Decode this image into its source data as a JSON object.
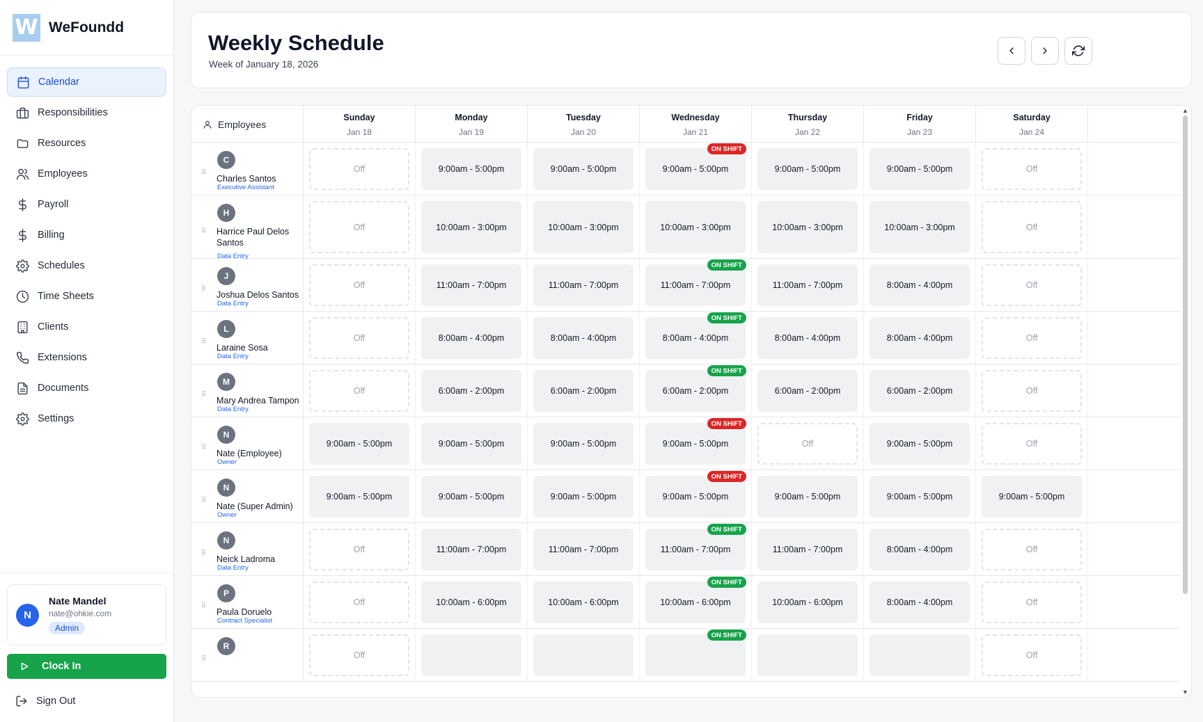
{
  "brand": {
    "logo_letter": "W",
    "name": "WeFoundd"
  },
  "sidebar": {
    "items": [
      {
        "label": "Calendar",
        "icon": "calendar-icon",
        "active": true
      },
      {
        "label": "Responsibilities",
        "icon": "briefcase-icon"
      },
      {
        "label": "Resources",
        "icon": "folder-icon"
      },
      {
        "label": "Employees",
        "icon": "users-icon"
      },
      {
        "label": "Payroll",
        "icon": "dollar-icon"
      },
      {
        "label": "Billing",
        "icon": "dollar-icon"
      },
      {
        "label": "Schedules",
        "icon": "gear-icon"
      },
      {
        "label": "Time Sheets",
        "icon": "clock-icon"
      },
      {
        "label": "Clients",
        "icon": "building-icon"
      },
      {
        "label": "Extensions",
        "icon": "phone-icon"
      },
      {
        "label": "Documents",
        "icon": "document-icon"
      },
      {
        "label": "Settings",
        "icon": "gear-icon"
      }
    ]
  },
  "user": {
    "initial": "N",
    "name": "Nate Mandel",
    "email": "nate@ohkie.com",
    "role": "Admin"
  },
  "clock_in_label": "Clock In",
  "sign_out_label": "Sign Out",
  "header": {
    "title": "Weekly Schedule",
    "subtitle": "Week of January 18, 2026"
  },
  "schedule": {
    "employees_header": "Employees",
    "days": [
      {
        "name": "Sunday",
        "date": "Jan 18"
      },
      {
        "name": "Monday",
        "date": "Jan 19"
      },
      {
        "name": "Tuesday",
        "date": "Jan 20"
      },
      {
        "name": "Wednesday",
        "date": "Jan 21"
      },
      {
        "name": "Thursday",
        "date": "Jan 22"
      },
      {
        "name": "Friday",
        "date": "Jan 23"
      },
      {
        "name": "Saturday",
        "date": "Jan 24"
      }
    ],
    "rows": [
      {
        "initial": "C",
        "name": "Charles Santos",
        "role": "Executive Assistant",
        "shifts": [
          "Off",
          "9:00am - 5:00pm",
          "9:00am - 5:00pm",
          "9:00am - 5:00pm",
          "9:00am - 5:00pm",
          "9:00am - 5:00pm",
          "Off"
        ],
        "badge": {
          "label": "ON SHIFT",
          "color": "#dc2626"
        }
      },
      {
        "initial": "H",
        "name": "Harrice Paul Delos Santos",
        "role": "Data Entry",
        "shifts": [
          "Off",
          "10:00am - 3:00pm",
          "10:00am - 3:00pm",
          "10:00am - 3:00pm",
          "10:00am - 3:00pm",
          "10:00am - 3:00pm",
          "Off"
        ],
        "badge": null
      },
      {
        "initial": "J",
        "name": "Joshua Delos Santos",
        "role": "Data Entry",
        "shifts": [
          "Off",
          "11:00am - 7:00pm",
          "11:00am - 7:00pm",
          "11:00am - 7:00pm",
          "11:00am - 7:00pm",
          "8:00am - 4:00pm",
          "Off"
        ],
        "badge": {
          "label": "ON SHIFT",
          "color": "#16a34a"
        }
      },
      {
        "initial": "L",
        "name": "Laraine Sosa",
        "role": "Data Entry",
        "shifts": [
          "Off",
          "8:00am - 4:00pm",
          "8:00am - 4:00pm",
          "8:00am - 4:00pm",
          "8:00am - 4:00pm",
          "8:00am - 4:00pm",
          "Off"
        ],
        "badge": {
          "label": "ON SHIFT",
          "color": "#16a34a"
        }
      },
      {
        "initial": "M",
        "name": "Mary Andrea Tampon",
        "role": "Data Entry",
        "shifts": [
          "Off",
          "6:00am - 2:00pm",
          "6:00am - 2:00pm",
          "6:00am - 2:00pm",
          "6:00am - 2:00pm",
          "6:00am - 2:00pm",
          "Off"
        ],
        "badge": {
          "label": "ON SHIFT",
          "color": "#16a34a"
        }
      },
      {
        "initial": "N",
        "name": "Nate (Employee)",
        "role": "Owner",
        "shifts": [
          "9:00am - 5:00pm",
          "9:00am - 5:00pm",
          "9:00am - 5:00pm",
          "9:00am - 5:00pm",
          "Off",
          "9:00am - 5:00pm",
          "Off"
        ],
        "badge": {
          "label": "ON SHIFT",
          "color": "#dc2626"
        }
      },
      {
        "initial": "N",
        "name": "Nate (Super Admin)",
        "role": "Owner",
        "shifts": [
          "9:00am - 5:00pm",
          "9:00am - 5:00pm",
          "9:00am - 5:00pm",
          "9:00am - 5:00pm",
          "9:00am - 5:00pm",
          "9:00am - 5:00pm",
          "9:00am - 5:00pm"
        ],
        "badge": {
          "label": "ON SHIFT",
          "color": "#dc2626"
        }
      },
      {
        "initial": "N",
        "name": "Neick Ladroma",
        "role": "Data Entry",
        "shifts": [
          "Off",
          "11:00am - 7:00pm",
          "11:00am - 7:00pm",
          "11:00am - 7:00pm",
          "11:00am - 7:00pm",
          "8:00am - 4:00pm",
          "Off"
        ],
        "badge": {
          "label": "ON SHIFT",
          "color": "#16a34a"
        }
      },
      {
        "initial": "P",
        "name": "Paula Doruelo",
        "role": "Contract Specialist",
        "shifts": [
          "Off",
          "10:00am - 6:00pm",
          "10:00am - 6:00pm",
          "10:00am - 6:00pm",
          "10:00am - 6:00pm",
          "8:00am - 4:00pm",
          "Off"
        ],
        "badge": {
          "label": "ON SHIFT",
          "color": "#16a34a"
        }
      },
      {
        "initial": "R",
        "name": "",
        "role": "",
        "shifts": [
          "Off",
          "",
          "",
          "",
          "",
          "",
          "Off"
        ],
        "badge": {
          "label": "ON SHIFT",
          "color": "#16a34a"
        }
      }
    ]
  }
}
